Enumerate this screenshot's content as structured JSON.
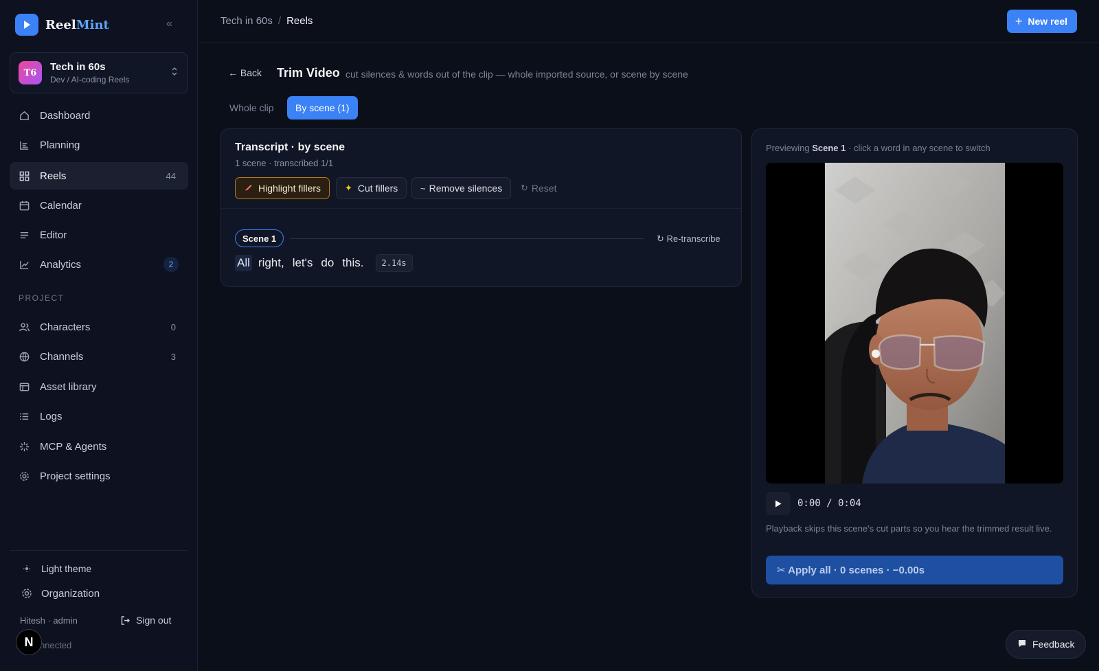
{
  "brand": {
    "name_part1": "Reel",
    "name_part2": "Mint",
    "collapse_icon": "«"
  },
  "project": {
    "initials": "T6",
    "name": "Tech in 60s",
    "subtitle": "Dev / AI-coding Reels"
  },
  "nav": [
    {
      "label": "Dashboard",
      "icon": "home-icon",
      "count": ""
    },
    {
      "label": "Planning",
      "icon": "planning-icon",
      "count": ""
    },
    {
      "label": "Reels",
      "icon": "grid-icon",
      "count": "44"
    },
    {
      "label": "Calendar",
      "icon": "calendar-icon",
      "count": ""
    },
    {
      "label": "Editor",
      "icon": "editor-icon",
      "count": ""
    },
    {
      "label": "Analytics",
      "icon": "chart-icon",
      "count": "2"
    }
  ],
  "section_label": "PROJECT",
  "project_nav": [
    {
      "label": "Characters",
      "icon": "users-icon",
      "count": "0"
    },
    {
      "label": "Channels",
      "icon": "globe-icon",
      "count": "3"
    },
    {
      "label": "Asset library",
      "icon": "library-icon",
      "count": ""
    },
    {
      "label": "Logs",
      "icon": "list-icon",
      "count": ""
    },
    {
      "label": "MCP & Agents",
      "icon": "spark-icon",
      "count": ""
    },
    {
      "label": "Project settings",
      "icon": "gear-icon",
      "count": ""
    }
  ],
  "footer": {
    "theme_label": "Light theme",
    "org_label": "Organization",
    "user": "Hitesh · admin",
    "signout": "Sign out",
    "connection": "nnected",
    "badge": "N"
  },
  "topbar": {
    "crumb_parent": "Tech in 60s",
    "crumb_sep": "/",
    "crumb_current": "Reels",
    "new_button": "New reel"
  },
  "page": {
    "back": "← Back",
    "title": "Trim Video",
    "subtitle": "cut silences & words out of the clip — whole imported source, or scene by scene",
    "tabs": [
      "Whole clip",
      "By scene (1)"
    ]
  },
  "transcript": {
    "title": "Transcript · by scene",
    "subtitle": "1 scene · transcribed 1/1",
    "buttons": {
      "highlight": "Highlight fillers",
      "cut": "Cut fillers",
      "remove": "Remove silences",
      "reset": "Reset"
    },
    "scene_label": "Scene 1",
    "retranscribe": "Re-transcribe",
    "words": [
      "All",
      "right,",
      "let's",
      "do",
      "this."
    ],
    "duration": "2.14s"
  },
  "preview": {
    "hint_prefix": "Previewing",
    "hint_scene": "Scene 1",
    "hint_suffix": "· click a word in any scene to switch",
    "timecode": "0:00 / 0:04",
    "note": "Playback skips this scene's cut parts so you hear the trimmed result live.",
    "apply": "✂ Apply all · 0 scenes · −0.00s"
  },
  "feedback": "Feedback",
  "colors": {
    "accent": "#3b82f6",
    "background": "#0b0f1a",
    "highlight_border": "#b7791f"
  }
}
